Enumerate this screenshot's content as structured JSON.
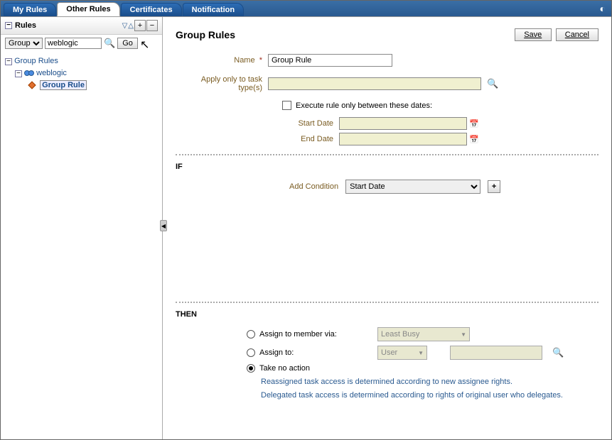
{
  "tabs": [
    "My Rules",
    "Other Rules",
    "Certificates",
    "Notification"
  ],
  "active_tab": 1,
  "sidebar": {
    "title": "Rules",
    "filter_type": "Group",
    "filter_value": "weblogic",
    "go": "Go",
    "tree": {
      "root": "Group Rules",
      "group": "weblogic",
      "rule": "Group Rule"
    }
  },
  "content": {
    "title": "Group Rules",
    "save": "Save",
    "cancel": "Cancel",
    "name_label": "Name",
    "name_value": "Group Rule",
    "apply_label": "Apply only to task type(s)",
    "execute_label": "Execute rule only between these dates:",
    "start_date_label": "Start Date",
    "end_date_label": "End Date",
    "if_title": "IF",
    "add_condition_label": "Add Condition",
    "condition_value": "Start Date",
    "then_title": "THEN",
    "then": {
      "assign_member": "Assign to member via:",
      "least_busy": "Least Busy",
      "assign_to": "Assign to:",
      "user": "User",
      "take_no_action": "Take no action",
      "info1": "Reassigned task access is determined according to new assignee rights.",
      "info2": "Delegated task access is determined according to rights of original user who delegates."
    }
  }
}
